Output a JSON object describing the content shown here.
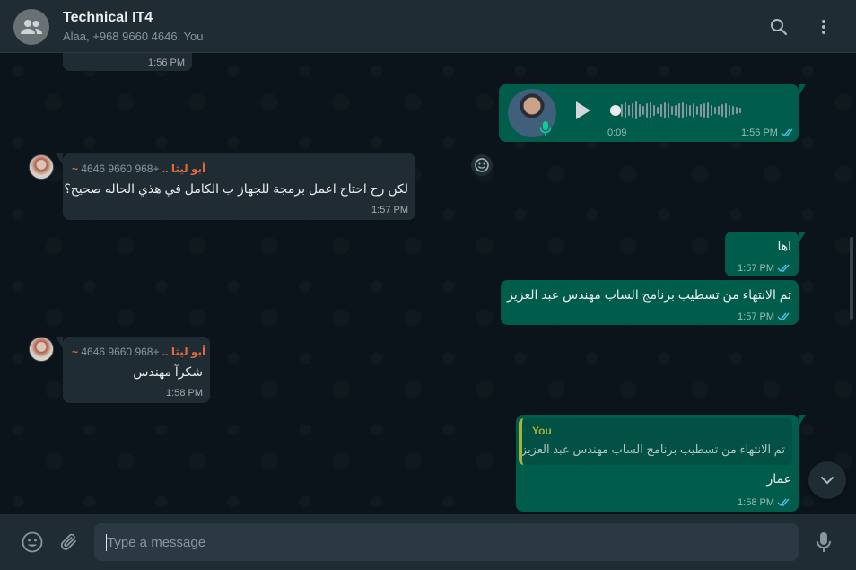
{
  "header": {
    "title": "Technical IT4",
    "subtitle": "Alaa, +968 9660 4646, You",
    "icons": [
      "group-icon",
      "search-icon",
      "menu-icon"
    ]
  },
  "messages": {
    "m0": {
      "time": "1:56 PM"
    },
    "voice": {
      "duration": "0:09",
      "time": "1:56 PM",
      "status": "read"
    },
    "m1": {
      "sender_phone": "+968 9660 4646",
      "sender_name": "~ أبو ليثا ..",
      "text": "لكن رح احتاج اعمل برمجة للجهاز ب الكامل في هذي الحاله صحيح؟",
      "time": "1:57 PM"
    },
    "m2": {
      "text": "اها",
      "time": "1:57 PM",
      "status": "read"
    },
    "m3": {
      "text": "تم الانتهاء من تسطيب برنامج الساب مهندس عبد العزيز",
      "time": "1:57 PM",
      "status": "read"
    },
    "m4": {
      "sender_phone": "+968 9660 4646",
      "sender_name": "~ أبو ليثا ..",
      "text": "شكرآ مهندس",
      "time": "1:58 PM"
    },
    "m5": {
      "quote_author": "You",
      "quote_text": "تم الانتهاء من تسطيب برنامج الساب مهندس عبد العزيز",
      "text": "عمار",
      "time": "1:58 PM",
      "status": "read"
    }
  },
  "composer": {
    "placeholder": "Type a message"
  },
  "colors": {
    "outgoing": "#005c4b",
    "incoming": "#202c33",
    "read_ticks": "#53bdeb",
    "sender_name": "#e26a3d",
    "quote_bar": "#a5b337"
  }
}
